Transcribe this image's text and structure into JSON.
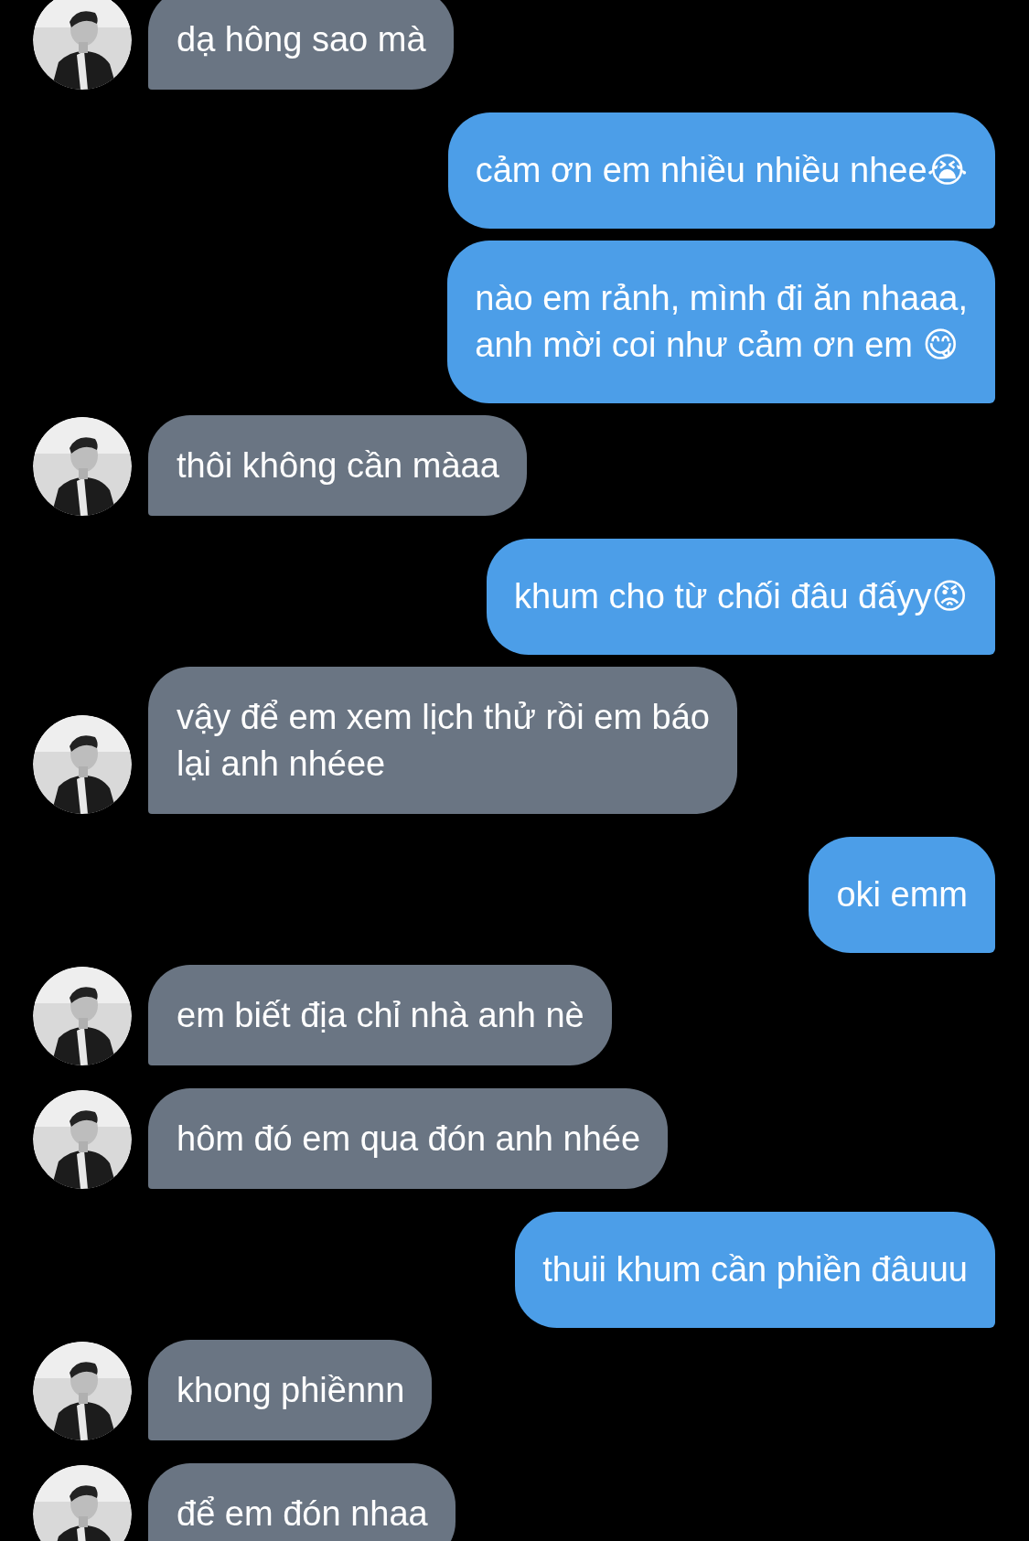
{
  "messages": [
    {
      "kind": "received",
      "text": "dạ hông sao mà"
    },
    {
      "kind": "sent",
      "text": "cảm ơn em nhiều nhiều nhee😭"
    },
    {
      "kind": "sent",
      "text": "nào em rảnh, mình đi ăn nhaaa,\nanh mời coi như cảm ơn em 😋"
    },
    {
      "kind": "received",
      "text": "thôi không cần màaa"
    },
    {
      "kind": "sent",
      "text": "khum cho từ chối đâu đấyy😡"
    },
    {
      "kind": "received",
      "text": "vậy để em xem lịch thử rồi em báo\nlại anh nhéee"
    },
    {
      "kind": "sent",
      "text": "oki emm"
    },
    {
      "kind": "received",
      "text": "em biết địa chỉ nhà anh nè"
    },
    {
      "kind": "received",
      "text": "hôm đó em qua đón anh nhée"
    },
    {
      "kind": "sent",
      "text": "thuii khum cần phiền đâuuu"
    },
    {
      "kind": "received",
      "text": "khong phiềnnn"
    },
    {
      "kind": "received",
      "text": "để em đón nhaa"
    }
  ]
}
